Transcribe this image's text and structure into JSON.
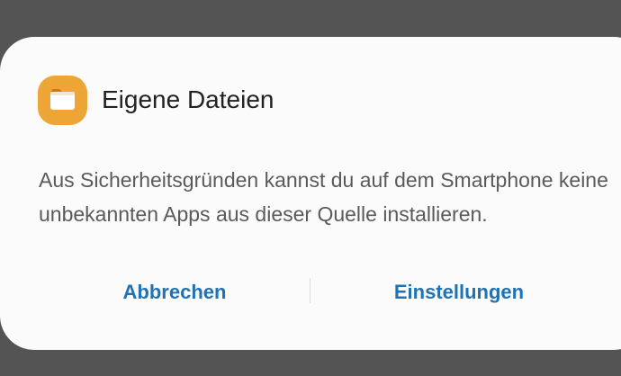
{
  "dialog": {
    "app_icon": "folder-icon",
    "title": "Eigene Dateien",
    "message": "Aus Sicherheitsgründen kannst du auf dem Smartphone keine unbekannten Apps aus dieser Quelle installieren.",
    "buttons": {
      "cancel_label": "Abbrechen",
      "settings_label": "Einstellungen"
    }
  },
  "colors": {
    "scrim": "#545454",
    "dialog_background": "#fbfbfb",
    "icon_background": "#eda635",
    "button_text": "#1f72b4",
    "title_text": "#222222",
    "message_text": "#5a5a5a"
  }
}
